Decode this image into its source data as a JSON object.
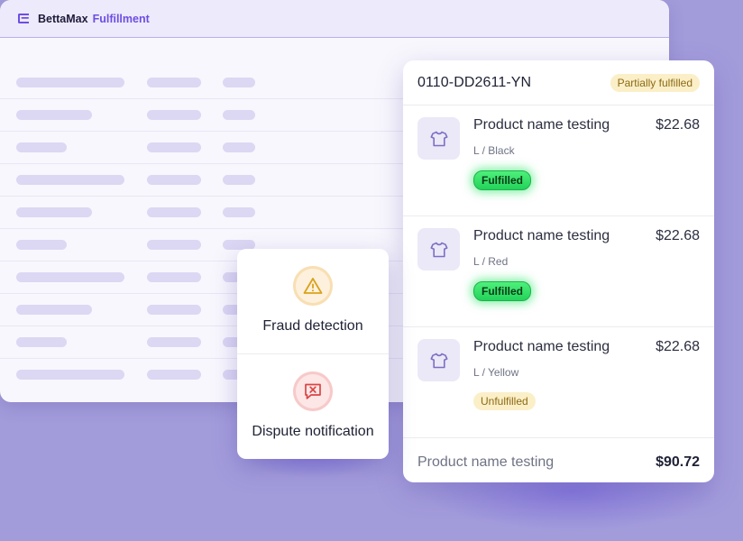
{
  "app": {
    "brand_name": "BettaMax",
    "section_name": "Fulfillment",
    "logo_icon": "stacked-layers-icon"
  },
  "colors": {
    "background": "#a39cdb",
    "accent": "#6d4ee3",
    "fulfilled_badge": "#2fe066",
    "pending_badge": "#fbefc8"
  },
  "order": {
    "id": "0110-DD2611-YN",
    "status": "Partially fulfilled",
    "items": [
      {
        "name": "Product name testing",
        "price": "$22.68",
        "variant": "L / Black",
        "status": "Fulfilled",
        "icon": "tshirt-icon"
      },
      {
        "name": "Product name testing",
        "price": "$22.68",
        "variant": "L / Red",
        "status": "Fulfilled",
        "icon": "tshirt-icon"
      },
      {
        "name": "Product name testing",
        "price": "$22.68",
        "variant": "L / Yellow",
        "status": "Unfulfilled",
        "icon": "tshirt-icon"
      }
    ],
    "footer": {
      "label": "Product name testing",
      "total": "$90.72"
    }
  },
  "alerts": [
    {
      "label": "Fraud detection",
      "icon": "warning-triangle-icon"
    },
    {
      "label": "Dispute notification",
      "icon": "message-x-icon"
    }
  ]
}
